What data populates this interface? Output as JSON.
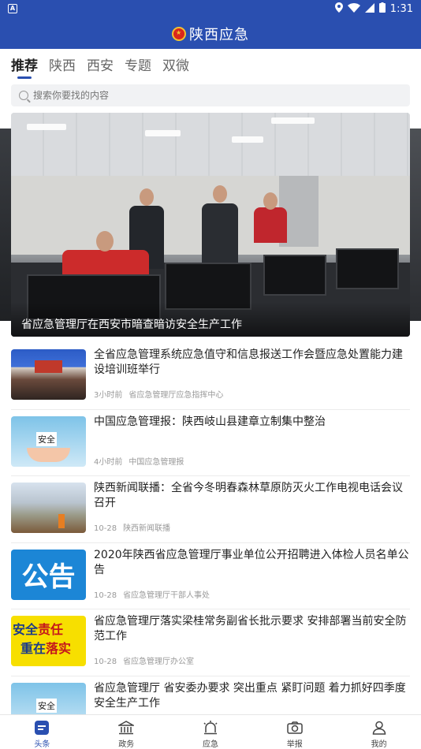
{
  "status_bar": {
    "time": "1:31"
  },
  "app": {
    "title": "陕西应急",
    "accent": "#2a4fb0"
  },
  "tabs": [
    {
      "label": "推荐",
      "active": true
    },
    {
      "label": "陕西",
      "active": false
    },
    {
      "label": "西安",
      "active": false
    },
    {
      "label": "专题",
      "active": false
    },
    {
      "label": "双微",
      "active": false
    }
  ],
  "search": {
    "placeholder": "搜索你要找的内容"
  },
  "banner": {
    "caption": "省应急管理厅在西安市暗查暗访安全生产工作"
  },
  "news": [
    {
      "title": "全省应急管理系统应急值守和信息报送工作会暨应急处置能力建设培训班举行",
      "time": "3小时前",
      "source": "省应急管理厅应急指挥中心"
    },
    {
      "title": "中国应急管理报：陕西岐山县建章立制集中整治",
      "time": "4小时前",
      "source": "中国应急管理报"
    },
    {
      "title": "陕西新闻联播：全省今冬明春森林草原防灭火工作电视电话会议召开",
      "time": "10-28",
      "source": "陕西新闻联播"
    },
    {
      "title": "2020年陕西省应急管理厅事业单位公开招聘进入体检人员名单公告",
      "time": "10-28",
      "source": "省应急管理厅干部人事处",
      "thumb_text": "公告"
    },
    {
      "title": "省应急管理厅落实梁桂常务副省长批示要求 安排部署当前安全防范工作",
      "time": "10-28",
      "source": "省应急管理厅办公室",
      "thumb_text_1a": "安全",
      "thumb_text_1b": "责任",
      "thumb_text_2a": "重在",
      "thumb_text_2b": "落实"
    },
    {
      "title": "省应急管理厅 省安委办要求 突出重点 紧盯问题 着力抓好四季度安全生产工作",
      "time": "",
      "source": ""
    }
  ],
  "bottom_nav": [
    {
      "label": "头条",
      "icon": "headline-icon",
      "active": true
    },
    {
      "label": "政务",
      "icon": "government-building-icon",
      "active": false
    },
    {
      "label": "应急",
      "icon": "alarm-light-icon",
      "active": false
    },
    {
      "label": "举报",
      "icon": "camera-icon",
      "active": false
    },
    {
      "label": "我的",
      "icon": "user-icon",
      "active": false
    }
  ]
}
